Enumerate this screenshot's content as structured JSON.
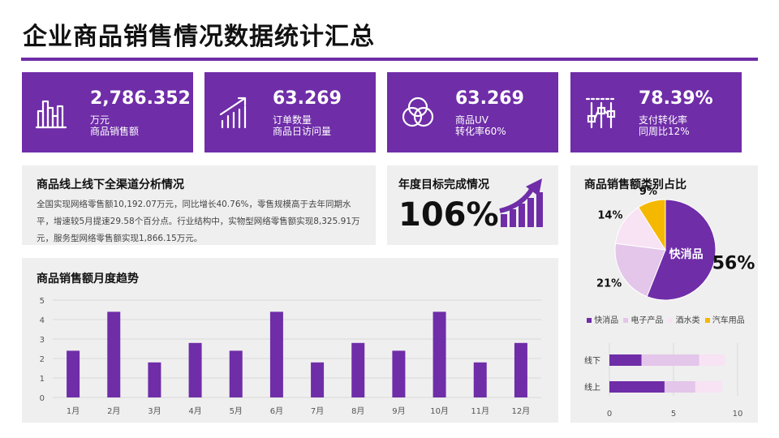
{
  "title": "企业商品销售情况数据统计汇总",
  "colors": {
    "primary": "#6f2da8",
    "light": "#e3c6ea",
    "lighter": "#f7e3f4",
    "accent": "#f5b800",
    "panel": "#efefef"
  },
  "kpis": [
    {
      "icon": "bar-chart-icon",
      "value": "2,786.352",
      "line1": "万元",
      "line2": "商品销售额"
    },
    {
      "icon": "trend-up-icon",
      "value": "63.269",
      "line1": "订单数量",
      "line2": "商品日访问量"
    },
    {
      "icon": "venn-circles-icon",
      "value": "63.269",
      "line1": "商品UV",
      "line2": "转化率60%"
    },
    {
      "icon": "slider-controls-icon",
      "value": "78.39%",
      "line1": "支付转化率",
      "line2": "同周比12%"
    }
  ],
  "analysis": {
    "title": "商品线上线下全渠道分析情况",
    "text": "全国实现网络零售额10,192.07万元，同比增长40.76%，零售规模高于去年同期水平，增速较5月提速29.58个百分点。行业结构中，实物型网络零售额实现8,325.91万元，服务型网络零售额实现1,866.15万元。"
  },
  "target": {
    "title": "年度目标完成情况",
    "value": "106%"
  },
  "share": {
    "title": "商品销售额类别占比"
  },
  "trend": {
    "title": "商品销售额月度趋势"
  },
  "chart_data": [
    {
      "type": "bar",
      "title": "商品销售额月度趋势",
      "categories": [
        "1月",
        "2月",
        "3月",
        "4月",
        "5月",
        "6月",
        "7月",
        "8月",
        "9月",
        "10月",
        "11月",
        "12月"
      ],
      "values": [
        2.4,
        4.4,
        1.8,
        2.8,
        2.4,
        4.4,
        1.8,
        2.8,
        2.4,
        4.4,
        1.8,
        2.8
      ],
      "ylim": [
        0,
        5
      ],
      "yticks": [
        0,
        1,
        2,
        3,
        4,
        5
      ],
      "grid": true
    },
    {
      "type": "pie",
      "title": "商品销售额类别占比",
      "labels": [
        "快消品",
        "电子产品",
        "酒水类",
        "汽车用品"
      ],
      "values": [
        56,
        21,
        14,
        9
      ],
      "value_labels": [
        "56%",
        "21%",
        "14%",
        "9%"
      ],
      "inner_label": "快消品",
      "legend": "bottom"
    },
    {
      "type": "bar",
      "orientation": "horizontal",
      "stacked": true,
      "categories": [
        "线下",
        "线上"
      ],
      "series": [
        {
          "values": [
            2.5,
            4.3
          ]
        },
        {
          "values": [
            4.5,
            2.4
          ]
        },
        {
          "values": [
            2.0,
            2.1
          ]
        }
      ],
      "xlim": [
        0,
        10
      ],
      "xticks": [
        0,
        5,
        10
      ],
      "grid": true
    }
  ]
}
